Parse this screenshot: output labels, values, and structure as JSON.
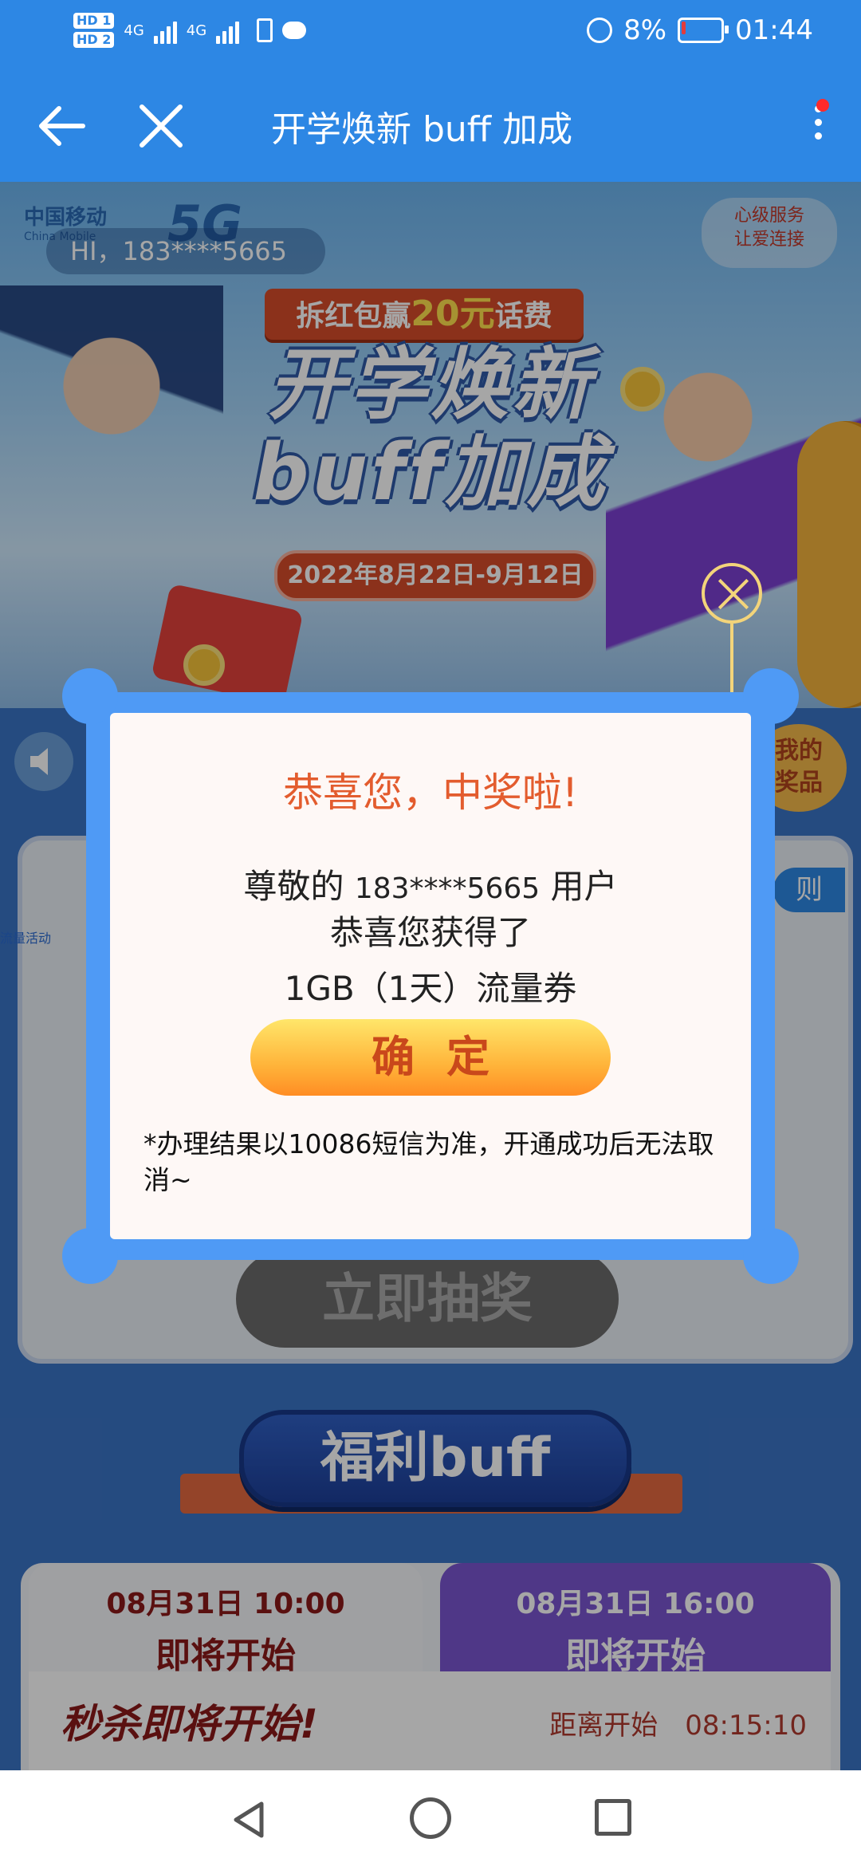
{
  "status_bar": {
    "sim1": "HD 1",
    "sim2": "HD 2",
    "net1": "4G",
    "net2": "4G",
    "battery_percent": "8%",
    "time": "01:44"
  },
  "title_bar": {
    "title": "开学焕新 buff 加成"
  },
  "banner": {
    "brand": "中国移动",
    "brand_en": "China Mobile",
    "network": "5G",
    "greeting": "HI，183****5665",
    "service_line1": "心级服务",
    "service_line2": "让爱连接",
    "ribbon_prefix": "拆红包赢",
    "ribbon_amount": "20元",
    "ribbon_suffix": "话费",
    "headline_line1": "开学焕新",
    "headline_line2": "buff加成",
    "date_range": "2022年8月22日-9月12日"
  },
  "page": {
    "my_prize_line1": "我的",
    "my_prize_line2": "奖品",
    "rules_tag": "则",
    "lottery_button": "立即抽奖",
    "side_label": "流量活动",
    "welfare_title": "福利buff",
    "slot1_time": "08月31日 10:00",
    "slot1_status": "即将开始",
    "slot2_time": "08月31日 16:00",
    "slot2_status": "即将开始",
    "seckill_title": "秒杀即将开始!",
    "countdown_label": "距离开始",
    "countdown_value": "08:15:10"
  },
  "modal": {
    "title": "恭喜您，中奖啦!",
    "line1_prefix": "尊敬的",
    "line1_number": "183****5665",
    "line1_suffix": "用户",
    "line2": "恭喜您获得了",
    "line3": "1GB（1天）流量券",
    "confirm_button": "确定",
    "note": "*办理结果以10086短信为准，开通成功后无法取消~"
  },
  "colors": {
    "accent_blue": "#2d87e4",
    "modal_title": "#e35c2e",
    "button_gold": "#ffb43a"
  }
}
